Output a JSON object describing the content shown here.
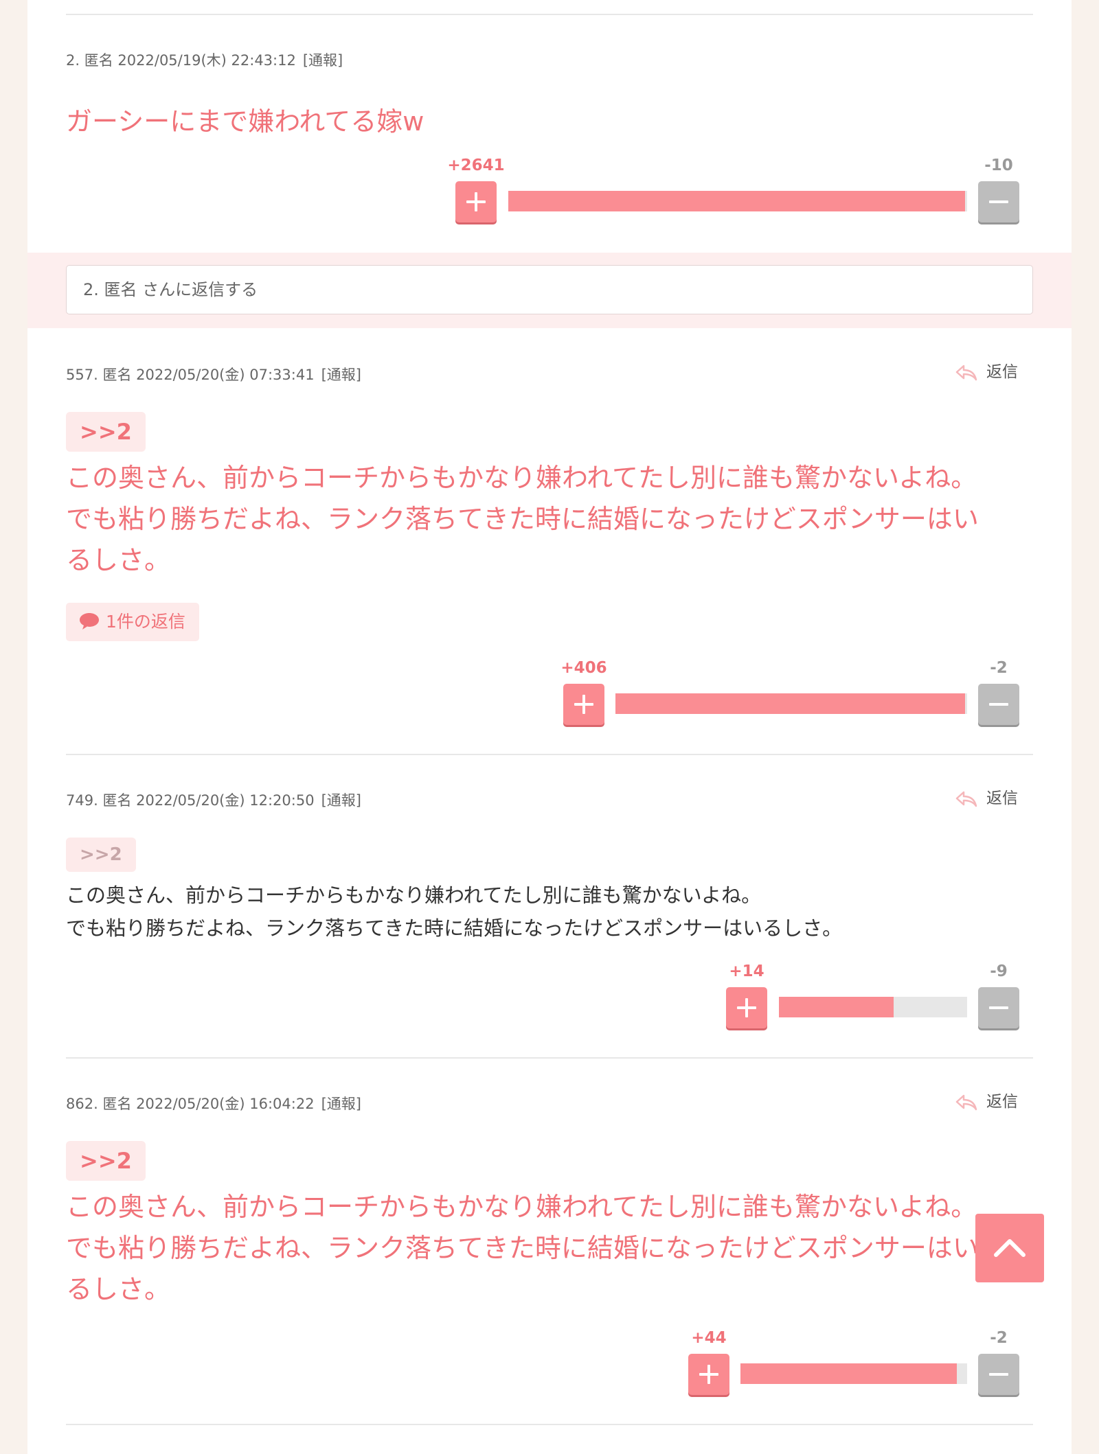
{
  "comments": [
    {
      "meta": {
        "number": "2.",
        "name": "匿名",
        "datetime": "2022/05/19(木) 22:43:12",
        "report": "[通報]"
      },
      "text": "ガーシーにまで嫌われてる嫁w",
      "votes": {
        "plus": "+2641",
        "minus": "-10",
        "ratio": 0.996
      }
    },
    {
      "meta": {
        "number": "557.",
        "name": "匿名",
        "datetime": "2022/05/20(金) 07:33:41",
        "report": "[通報]"
      },
      "reply_label": "返信",
      "anchor": ">>2",
      "lines": [
        "この奥さん、前からコーチからもかなり嫌われてたし別に誰も驚かないよね。",
        "でも粘り勝ちだよね、ランク落ちてきた時に結婚になったけどスポンサーはい",
        "るしさ。"
      ],
      "replies_label": "1件の返信",
      "votes": {
        "plus": "+406",
        "minus": "-2",
        "ratio": 0.995
      }
    },
    {
      "meta": {
        "number": "749.",
        "name": "匿名",
        "datetime": "2022/05/20(金) 12:20:50",
        "report": "[通報]"
      },
      "reply_label": "返信",
      "anchor": ">>2",
      "lines": [
        "この奥さん、前からコーチからもかなり嫌われてたし別に誰も驚かないよね。",
        "でも粘り勝ちだよね、ランク落ちてきた時に結婚になったけどスポンサーはいるしさ。"
      ],
      "votes": {
        "plus": "+14",
        "minus": "-9",
        "ratio": 0.61
      }
    },
    {
      "meta": {
        "number": "862.",
        "name": "匿名",
        "datetime": "2022/05/20(金) 16:04:22",
        "report": "[通報]"
      },
      "reply_label": "返信",
      "anchor": ">>2",
      "lines": [
        "この奥さん、前からコーチからもかなり嫌われてたし別に誰も驚かないよね。",
        "でも粘り勝ちだよね、ランク落ちてきた時に結婚になったけどスポンサーはい",
        "るしさ。"
      ],
      "votes": {
        "plus": "+44",
        "minus": "-2",
        "ratio": 0.955
      }
    }
  ],
  "reply_box": {
    "placeholder": "2. 匿名 さんに返信する"
  },
  "colors": {
    "accent": "#f07279",
    "plus_button": "#fa8a90",
    "bar_fill": "#fa8d93",
    "minus_button": "#bdbdbd",
    "page_bg": "#f9f2ec"
  },
  "icons": {
    "reply": "reply-arrow-icon",
    "replies": "speech-bubble-icon",
    "scroll_top": "chevron-up-icon"
  }
}
